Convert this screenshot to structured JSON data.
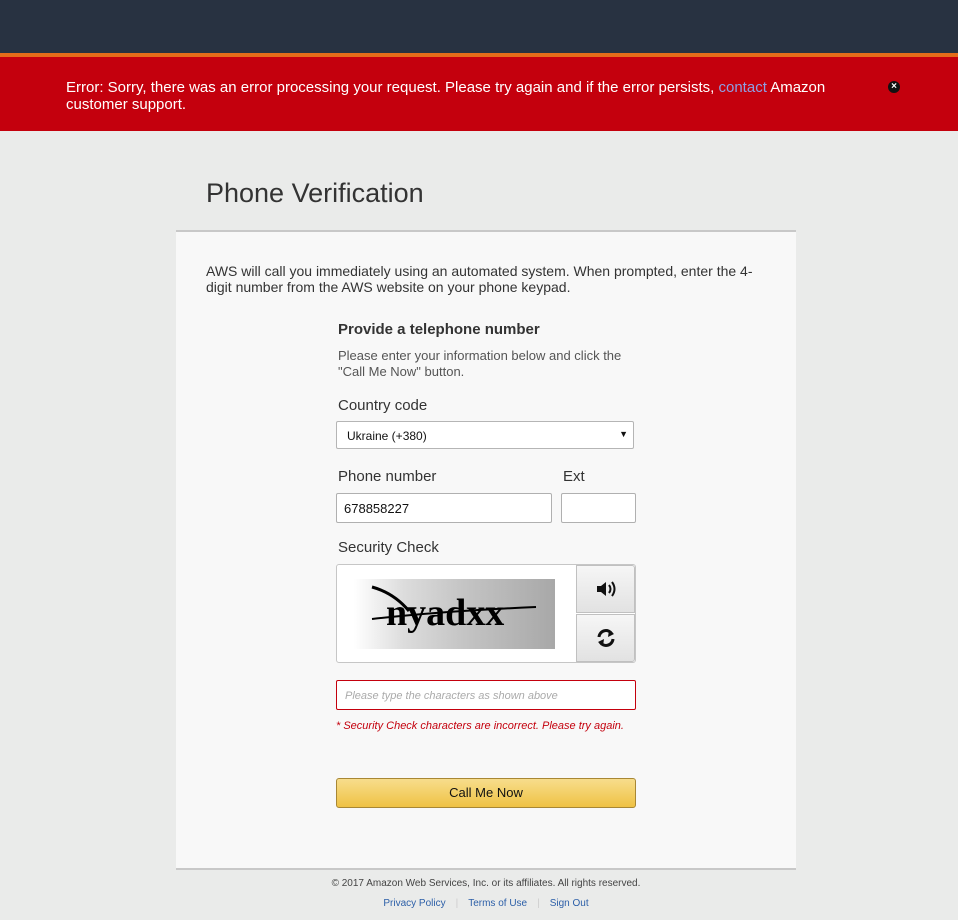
{
  "error_banner": {
    "text_before": "Error: Sorry, there was an error processing your request. Please try again and if the error persists, ",
    "link": "contact",
    "text_after": " Amazon customer support.",
    "close_icon": "close-circle-icon"
  },
  "page": {
    "title": "Phone Verification",
    "intro": "AWS will call you immediately using an automated system. When prompted, enter the 4-digit number from the AWS website on your phone keypad."
  },
  "form": {
    "heading": "Provide a telephone number",
    "help": "Please enter your information below and click the \"Call Me Now\" button.",
    "country_label": "Country code",
    "country_value": "Ukraine (+380)",
    "phone_label": "Phone number",
    "phone_value": "678858227",
    "ext_label": "Ext",
    "ext_value": "",
    "security_label": "Security Check",
    "captcha_text": "nyadxx",
    "audio_icon": "speaker-icon",
    "refresh_icon": "refresh-icon",
    "captcha_placeholder": "Please type the characters as shown above",
    "captcha_error": "* Security Check characters are incorrect. Please try again.",
    "submit_label": "Call Me Now"
  },
  "footer": {
    "copyright": "© 2017 Amazon Web Services, Inc. or its affiliates. All rights reserved.",
    "links": [
      "Privacy Policy",
      "Terms of Use",
      "Sign Out"
    ]
  },
  "colors": {
    "topbar": "#283241",
    "accent": "#e56c1a",
    "error": "#c4000d",
    "button": "#efc244"
  }
}
